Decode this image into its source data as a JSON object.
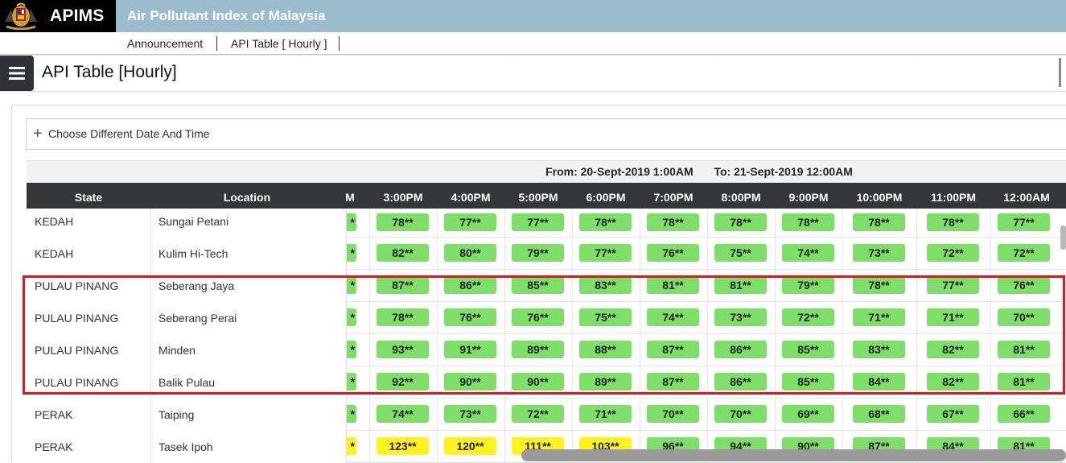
{
  "app": {
    "brand": "APIMS",
    "site_title": "Air Pollutant Index of Malaysia"
  },
  "nav": {
    "items": [
      {
        "label": "Announcement"
      },
      {
        "label": "API Table [ Hourly ]"
      }
    ]
  },
  "header": {
    "title": "API Table [Hourly]"
  },
  "filter": {
    "choose_label": "Choose Different Date And Time",
    "plus_icon": "+"
  },
  "table": {
    "from_label": "From: 20-Sept-2019  1:00AM",
    "to_label": "To: 21-Sept-2019  12:00AM",
    "columns": {
      "state": "State",
      "location": "Location",
      "partial": "M",
      "hours": [
        "3:00PM",
        "4:00PM",
        "5:00PM",
        "6:00PM",
        "7:00PM",
        "8:00PM",
        "9:00PM",
        "10:00PM",
        "11:00PM",
        "12:00AM"
      ]
    },
    "rows": [
      {
        "state": "KEDAH",
        "location": "Sungai Petani",
        "partial": "*",
        "values": [
          "78**",
          "77**",
          "77**",
          "78**",
          "78**",
          "78**",
          "78**",
          "78**",
          "78**",
          "77**"
        ],
        "levels": [
          "g",
          "g",
          "g",
          "g",
          "g",
          "g",
          "g",
          "g",
          "g",
          "g"
        ]
      },
      {
        "state": "KEDAH",
        "location": "Kulim Hi-Tech",
        "partial": "*",
        "values": [
          "82**",
          "80**",
          "79**",
          "77**",
          "76**",
          "75**",
          "74**",
          "73**",
          "72**",
          "72**"
        ],
        "levels": [
          "g",
          "g",
          "g",
          "g",
          "g",
          "g",
          "g",
          "g",
          "g",
          "g"
        ]
      },
      {
        "state": "PULAU PINANG",
        "location": "Seberang Jaya",
        "partial": "*",
        "values": [
          "87**",
          "86**",
          "85**",
          "83**",
          "81**",
          "81**",
          "79**",
          "78**",
          "77**",
          "76**"
        ],
        "levels": [
          "g",
          "g",
          "g",
          "g",
          "g",
          "g",
          "g",
          "g",
          "g",
          "g"
        ]
      },
      {
        "state": "PULAU PINANG",
        "location": "Seberang Perai",
        "partial": "*",
        "values": [
          "78**",
          "76**",
          "76**",
          "75**",
          "74**",
          "73**",
          "72**",
          "71**",
          "71**",
          "70**"
        ],
        "levels": [
          "g",
          "g",
          "g",
          "g",
          "g",
          "g",
          "g",
          "g",
          "g",
          "g"
        ]
      },
      {
        "state": "PULAU PINANG",
        "location": "Minden",
        "partial": "*",
        "values": [
          "93**",
          "91**",
          "89**",
          "88**",
          "87**",
          "86**",
          "85**",
          "83**",
          "82**",
          "81**"
        ],
        "levels": [
          "g",
          "g",
          "g",
          "g",
          "g",
          "g",
          "g",
          "g",
          "g",
          "g"
        ]
      },
      {
        "state": "PULAU PINANG",
        "location": "Balik Pulau",
        "partial": "*",
        "values": [
          "92**",
          "90**",
          "90**",
          "89**",
          "87**",
          "86**",
          "85**",
          "84**",
          "82**",
          "81**"
        ],
        "levels": [
          "g",
          "g",
          "g",
          "g",
          "g",
          "g",
          "g",
          "g",
          "g",
          "g"
        ]
      },
      {
        "state": "PERAK",
        "location": "Taiping",
        "partial": "*",
        "values": [
          "74**",
          "73**",
          "72**",
          "71**",
          "70**",
          "70**",
          "69**",
          "68**",
          "67**",
          "66**"
        ],
        "levels": [
          "g",
          "g",
          "g",
          "g",
          "g",
          "g",
          "g",
          "g",
          "g",
          "g"
        ]
      },
      {
        "state": "PERAK",
        "location": "Tasek Ipoh",
        "partial": "*",
        "values": [
          "123**",
          "120**",
          "111**",
          "103**",
          "96**",
          "94**",
          "90**",
          "87**",
          "84**",
          "81**"
        ],
        "levels": [
          "y",
          "y",
          "y",
          "y",
          "g",
          "g",
          "g",
          "g",
          "g",
          "g"
        ]
      }
    ]
  },
  "colors": {
    "good": "#7ddf67",
    "moderate_high": "#fff21f",
    "highlight": "#e0161f",
    "header_bg": "#33373a",
    "topbar_bg": "#9bbccd"
  }
}
